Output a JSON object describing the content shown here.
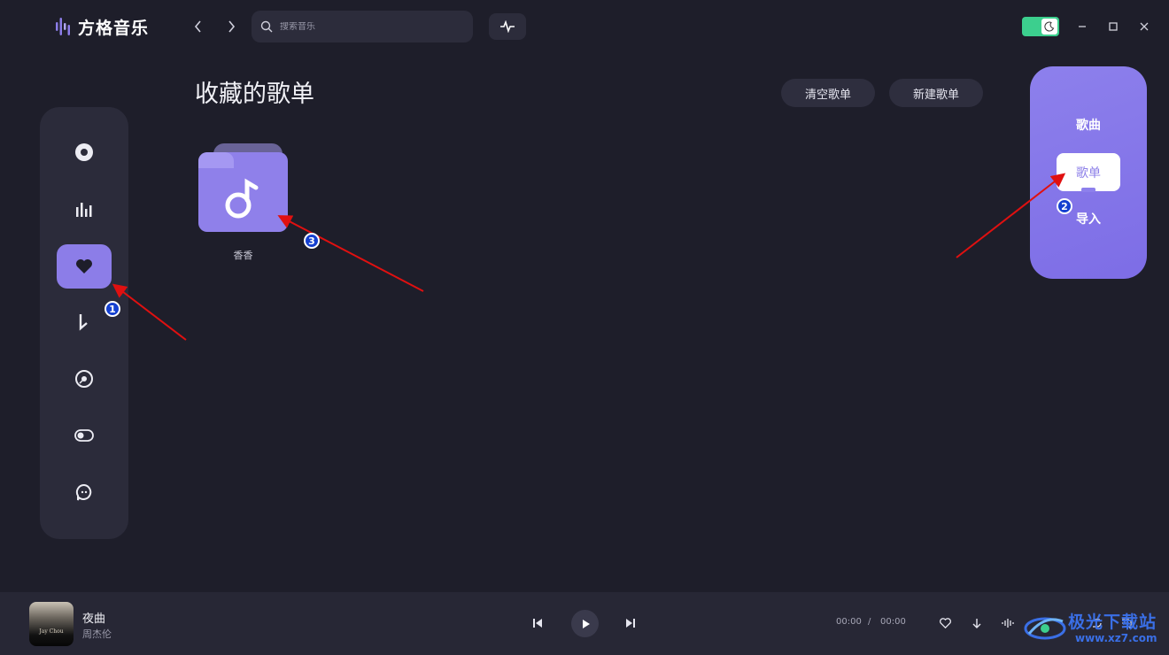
{
  "app": {
    "name": "方格音乐"
  },
  "search": {
    "placeholder": "搜索音乐"
  },
  "main": {
    "title": "收藏的歌单",
    "clear_button": "清空歌单",
    "new_button": "新建歌单",
    "playlists": [
      {
        "name": "香香"
      }
    ]
  },
  "popup": {
    "label_top": "歌曲",
    "selected_option": "歌单",
    "label_bottom": "导入"
  },
  "sidebar": {
    "items": [
      "disc-icon",
      "chart-icon",
      "heart-icon",
      "download-icon",
      "vinyl-icon",
      "toggle-icon",
      "chat-icon"
    ],
    "active_index": 2
  },
  "annotations": [
    "1",
    "2",
    "3"
  ],
  "player": {
    "song_title": "夜曲",
    "artist": "周杰伦",
    "album_text": "Jay Chou",
    "current_time": "00:00",
    "separator": "/",
    "total_time": "00:00"
  },
  "watermark": {
    "text": "极光下载站",
    "url": "www.xz7.com"
  },
  "colors": {
    "background": "#1e1e2a",
    "accent": "#8c7de8",
    "toggle": "#3ccf8e",
    "annotation_arrow": "#e01010",
    "badge": "#1540d0"
  }
}
